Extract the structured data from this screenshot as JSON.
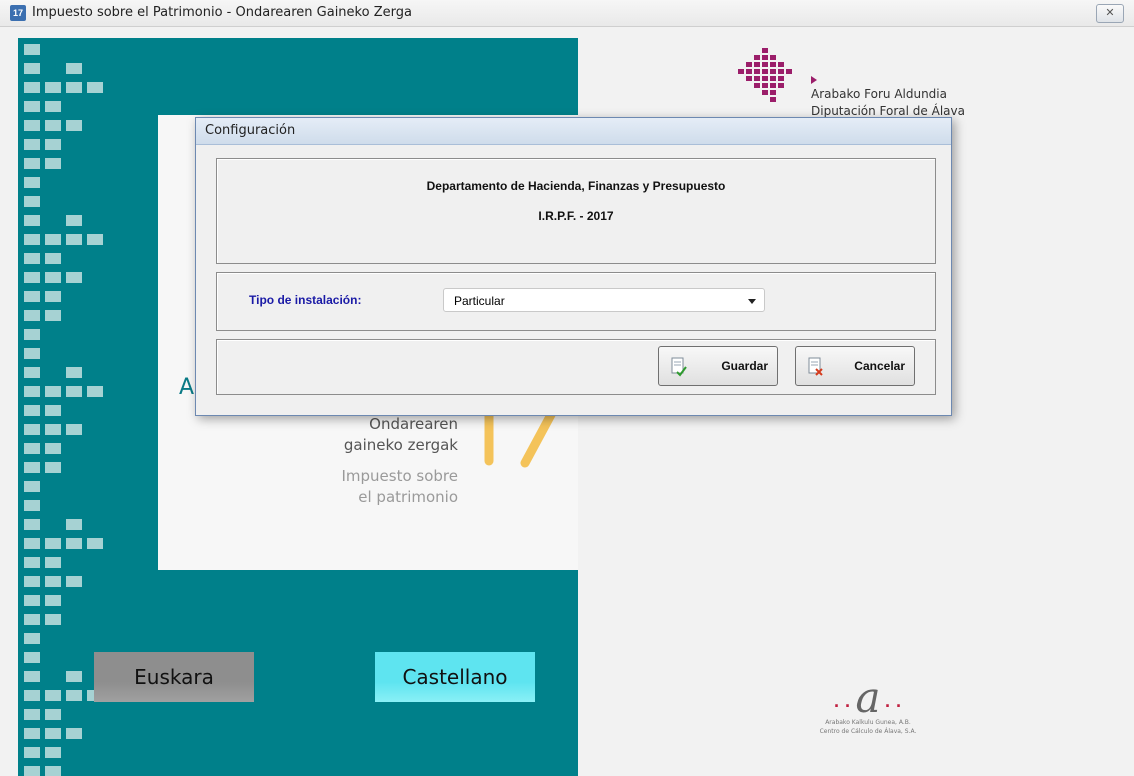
{
  "window": {
    "title": "Impuesto sobre el Patrimonio - Ondarearen Gaineko Zerga",
    "app_icon": "17-badge-icon",
    "close_glyph": "✕"
  },
  "branding": {
    "org_line1": "Arabako Foru Aldundia",
    "org_line2": "Diputación Foral de Álava",
    "tagline_eu_1": "Ondarearen",
    "tagline_eu_2": "gaineko zergak",
    "tagline_es_1": "Impuesto sobre",
    "tagline_es_2": "el patrimonio",
    "partial_letter": "A",
    "ccaa_line1": "Arabako Kalkulu Gunea, A.B.",
    "ccaa_line2": "Centro de Cálculo de Álava, S.A.",
    "accent_teal": "#00808a",
    "accent_magenta": "#9b1e6a",
    "accent_orange": "#f4c35a"
  },
  "language_buttons": {
    "euskara": "Euskara",
    "castellano": "Castellano"
  },
  "dialog": {
    "title": "Configuración",
    "department": "Departamento de Hacienda, Finanzas y Presupuesto",
    "irpf": "I.R.P.F. - 2017",
    "tipo_label": "Tipo de instalación:",
    "tipo_value": "Particular",
    "save_label": "Guardar",
    "cancel_label": "Cancelar"
  }
}
